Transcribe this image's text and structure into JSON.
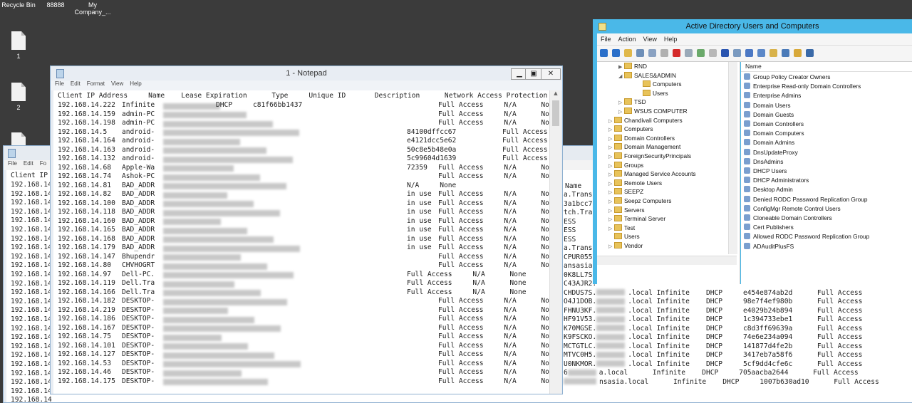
{
  "desktop": {
    "icons": [
      "Recycle Bin",
      "88888",
      "My Company_...",
      "1",
      "2"
    ]
  },
  "notepad_front": {
    "title": "1 - Notepad",
    "menu": [
      "File",
      "Edit",
      "Format",
      "View",
      "Help"
    ],
    "header": "Client IP Address     Name    Lease Expiration      Type     Unique ID       Description      Network Access Protection",
    "rows": [
      {
        "ip": "192.168.14.222",
        "name": "Infinite",
        "pre": "",
        "mid": "DHCP     c81f66bb1437",
        "post": "Full Access     N/A      None"
      },
      {
        "ip": "192.168.14.159",
        "name": "admin-PC",
        "pre": "",
        "mid": "",
        "post": "Full Access     N/A      None"
      },
      {
        "ip": "192.168.14.198",
        "name": "admin-PC",
        "pre": "",
        "mid": "",
        "post": "Full Access     N/A      None"
      },
      {
        "ip": "192.168.14.5",
        "name": "android-",
        "pre": "",
        "mid": "84100dffcc67",
        "post": "Full Access     N/A      None"
      },
      {
        "ip": "192.168.14.164",
        "name": "android-",
        "pre": "",
        "mid": "e4121dcc5e62",
        "post": "Full Access     N/A      None"
      },
      {
        "ip": "192.168.14.163",
        "name": "android-",
        "pre": "",
        "mid": "50c8e5b48e0a",
        "post": "Full Access     N/A      None"
      },
      {
        "ip": "192.168.14.132",
        "name": "android-",
        "pre": "",
        "mid": "5c99604d1639",
        "post": "Full Access     N/A      None"
      },
      {
        "ip": "192.168.14.68",
        "name": "Apple-Wa",
        "pre": "",
        "mid": "72359",
        "post": "Full Access     N/A      None"
      },
      {
        "ip": "192.168.14.74",
        "name": "Ashok-PC",
        "pre": "",
        "mid": "",
        "post": "Full Access     N/A      None"
      },
      {
        "ip": "192.168.14.81",
        "name": "BAD_ADDR",
        "pre": "",
        "mid": "N/A     None",
        "post": ""
      },
      {
        "ip": "192.168.14.82",
        "name": "BAD_ADDR",
        "pre": "",
        "mid": "in use",
        "post": "Full Access     N/A      None"
      },
      {
        "ip": "192.168.14.100",
        "name": "BAD_ADDR",
        "pre": "",
        "mid": "in use",
        "post": "Full Access     N/A      None"
      },
      {
        "ip": "192.168.14.118",
        "name": "BAD_ADDR",
        "pre": "",
        "mid": "in use",
        "post": "Full Access     N/A      None"
      },
      {
        "ip": "192.168.14.160",
        "name": "BAD_ADDR",
        "pre": "",
        "mid": "in use",
        "post": "Full Access     N/A      None"
      },
      {
        "ip": "192.168.14.165",
        "name": "BAD_ADDR",
        "pre": "",
        "mid": "in use",
        "post": "Full Access     N/A      None"
      },
      {
        "ip": "192.168.14.168",
        "name": "BAD_ADDR",
        "pre": "",
        "mid": "in use",
        "post": "Full Access     N/A      None"
      },
      {
        "ip": "192.168.14.179",
        "name": "BAD_ADDR",
        "pre": "",
        "mid": "in use",
        "post": "Full Access     N/A      None"
      },
      {
        "ip": "192.168.14.147",
        "name": "Bhupendr",
        "pre": "",
        "mid": "",
        "post": "Full Access     N/A      None"
      },
      {
        "ip": "192.168.14.80",
        "name": "CHVHOGRT",
        "pre": "",
        "mid": "",
        "post": "Full Access     N/A      None"
      },
      {
        "ip": "192.168.14.97",
        "name": "Dell-PC.",
        "pre": "",
        "mid": "Full Access     N/A      None",
        "post": ""
      },
      {
        "ip": "192.168.14.119",
        "name": "Dell.Tra",
        "pre": "",
        "mid": "Full Access     N/A      None",
        "post": ""
      },
      {
        "ip": "192.168.14.166",
        "name": "Dell.Tra",
        "pre": "",
        "mid": "Full Access     N/A      None",
        "post": ""
      },
      {
        "ip": "192.168.14.182",
        "name": "DESKTOP-",
        "pre": "",
        "mid": "",
        "post": "Full Access     N/A      None"
      },
      {
        "ip": "192.168.14.219",
        "name": "DESKTOP-",
        "pre": "",
        "mid": "",
        "post": "Full Access     N/A      None"
      },
      {
        "ip": "192.168.14.186",
        "name": "DESKTOP-",
        "pre": "",
        "mid": "",
        "post": "Full Access     N/A      None"
      },
      {
        "ip": "192.168.14.167",
        "name": "DESKTOP-",
        "pre": "",
        "mid": "",
        "post": "Full Access     N/A      None"
      },
      {
        "ip": "192.168.14.75",
        "name": "DESKTOP-",
        "pre": "",
        "mid": "",
        "post": "Full Access     N/A      None"
      },
      {
        "ip": "192.168.14.101",
        "name": "DESKTOP-",
        "pre": "",
        "mid": "",
        "post": "Full Access     N/A      None"
      },
      {
        "ip": "192.168.14.127",
        "name": "DESKTOP-",
        "pre": "",
        "mid": "",
        "post": "Full Access     N/A      None"
      },
      {
        "ip": "192.168.14.53",
        "name": "DESKTOP-",
        "pre": "",
        "mid": "",
        "post": "Full Access     N/A      None"
      },
      {
        "ip": "192.168.14.46",
        "name": "DESKTOP-",
        "pre": "",
        "mid": "",
        "post": "Full Access     N/A      None"
      },
      {
        "ip": "192.168.14.175",
        "name": "DESKTOP-",
        "pre": "",
        "mid": "",
        "post": "Full Access     N/A      None"
      }
    ]
  },
  "notepad_back": {
    "menu": [
      "File",
      "Edit",
      "Fo"
    ],
    "header": "Client IP",
    "ips": [
      "192.168.14",
      "192.168.14",
      "192.168.14",
      "192.168.14",
      "192.168.14",
      "192.168.14",
      "192.168.14",
      "192.168.14",
      "192.168.14",
      "192.168.14",
      "192.168.14",
      "192.168.14",
      "192.168.14",
      "192.168.14",
      "192.168.14",
      "192.168.14",
      "192.168.14",
      "192.168.14",
      "192.168.14",
      "192.168.14",
      "192.168.14",
      "192.168.14",
      "192.168.14",
      "192.168.14",
      "192.168.14",
      "192.168.14",
      "192.168.14"
    ],
    "right_header": "Name",
    "right_rows": [
      {
        "left": "a.Transas",
        "right": ""
      },
      {
        "left": "3a1bcc77",
        "right": ""
      },
      {
        "left": "tch.Tra",
        "right": ""
      },
      {
        "left": "ESS",
        "right": ""
      },
      {
        "left": "ESS",
        "right": ""
      },
      {
        "left": "ESS",
        "right": ""
      },
      {
        "left": "a.Transa",
        "right": ""
      },
      {
        "left": "CPUR055.",
        "right": ""
      },
      {
        "left": "ansasia.l",
        "right": ""
      },
      {
        "left": "0K8LL7S.",
        "right": ""
      },
      {
        "left": "C43AJR2.",
        "right": ""
      },
      {
        "left": "CHDUS7S.",
        "right": ".local Infinite    DHCP     e454e874ab2d      Full Access"
      },
      {
        "left": "O4J1DOB.",
        "right": ".local Infinite    DHCP     98e7f4ef980b      Full Access"
      },
      {
        "left": "FHNU3KF.",
        "right": ".local Infinite    DHCP     e4029b24b894      Full Access"
      },
      {
        "left": "HF91V53.",
        "right": ".local Infinite    DHCP     1c394733ebe1      Full Access"
      },
      {
        "left": "K70MGSE.",
        "right": ".local Infinite    DHCP     c8d3ff69639a      Full Access"
      },
      {
        "left": "K9FSCKO.",
        "right": ".local Infinite    DHCP     74e6e234a094      Full Access"
      },
      {
        "left": "MCTGTLC.",
        "right": ".local Infinite    DHCP     141877d4fe2b      Full Access"
      },
      {
        "left": "MTVC0H5.",
        "right": ".local Infinite    DHCP     3417eb7a58f6      Full Access"
      },
      {
        "left": "U0NKMOR.",
        "right": ".local Infinite    DHCP     5cf9dd4cfe6c      Full Access"
      },
      {
        "left": "6",
        "right": "a.local      Infinite    DHCP     705aacba2644      Full Access"
      },
      {
        "left": "",
        "right": "nsasia.local      Infinite    DHCP     1007b630ad10      Full Access"
      }
    ]
  },
  "ad": {
    "title": "Active Directory Users and Computers",
    "menu": [
      "File",
      "Action",
      "View",
      "Help"
    ],
    "tree": [
      {
        "label": "RND",
        "x": 30,
        "exp": "▶"
      },
      {
        "label": "SALES&ADMIN",
        "x": 30,
        "exp": "◢"
      },
      {
        "label": "Computers",
        "x": 56,
        "exp": ""
      },
      {
        "label": "Users",
        "x": 56,
        "exp": ""
      },
      {
        "label": "TSD",
        "x": 30,
        "exp": "▷"
      },
      {
        "label": "WSUS COMPUTER",
        "x": 30,
        "exp": "▷"
      },
      {
        "label": "Chandivali Computers",
        "x": 16,
        "exp": "▷"
      },
      {
        "label": "Computers",
        "x": 16,
        "exp": "▷"
      },
      {
        "label": "Domain Controllers",
        "x": 16,
        "exp": "▷"
      },
      {
        "label": "Domain Management",
        "x": 16,
        "exp": "▷"
      },
      {
        "label": "ForeignSecurityPrincipals",
        "x": 16,
        "exp": "▷"
      },
      {
        "label": "Groups",
        "x": 16,
        "exp": "▷"
      },
      {
        "label": "Managed Service Accounts",
        "x": 16,
        "exp": "▷"
      },
      {
        "label": "Remote Users",
        "x": 16,
        "exp": "▷"
      },
      {
        "label": "SEEPZ",
        "x": 16,
        "exp": "▷"
      },
      {
        "label": "Seepz Computers",
        "x": 16,
        "exp": "▷"
      },
      {
        "label": "Servers",
        "x": 16,
        "exp": "▷"
      },
      {
        "label": "Terminal Server",
        "x": 16,
        "exp": "▷"
      },
      {
        "label": "Test",
        "x": 16,
        "exp": "▷"
      },
      {
        "label": "Users",
        "x": 16,
        "exp": ""
      },
      {
        "label": "Vendor",
        "x": 16,
        "exp": "▷"
      }
    ],
    "list_header": "Name",
    "list": [
      "Group Policy Creator Owners",
      "Enterprise Read-only Domain Controllers",
      "Enterprise Admins",
      "Domain Users",
      "Domain Guests",
      "Domain Controllers",
      "Domain Computers",
      "Domain Admins",
      "DnsUpdateProxy",
      "DnsAdmins",
      "DHCP Users",
      "DHCP Administrators",
      "Desktop Admin",
      "Denied RODC Password Replication Group",
      "ConfigMgr Remote Control Users",
      "Cloneable Domain Controllers",
      "Cert Publishers",
      "Allowed RODC Password Replication Group",
      "ADAuditPlusFS"
    ]
  }
}
